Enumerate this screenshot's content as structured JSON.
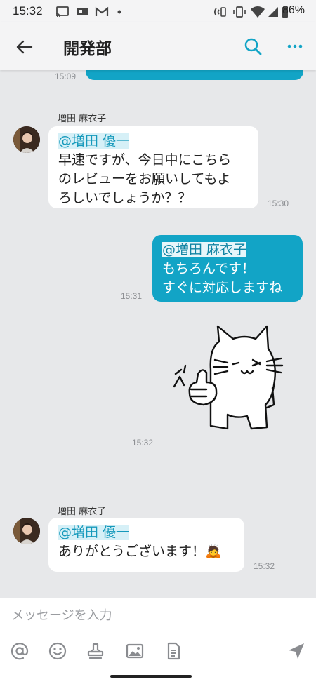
{
  "status_bar": {
    "time": "15:32",
    "battery": "86%"
  },
  "header": {
    "title": "開発部"
  },
  "messages": [
    {
      "time": "15:09"
    },
    {
      "sender": "増田 麻衣子",
      "mention": "@増田 優一",
      "lines": [
        "早速ですが、今日中にこちら",
        "のレビューをお願いしてもよ",
        "ろしいでしょうか？？"
      ],
      "time": "15:30"
    },
    {
      "mention": "@増田 麻衣子",
      "lines": [
        "もちろんです！",
        "すぐに対応しますね"
      ],
      "time": "15:31"
    },
    {
      "type": "sticker",
      "sticker": "cat-thumbs-up-sticker",
      "time": "15:32"
    },
    {
      "sender": "増田 麻衣子",
      "mention": "@増田 優一",
      "lines": [
        "ありがとうございます！"
      ],
      "emoji": "🙇",
      "time": "15:32"
    }
  ],
  "composer": {
    "placeholder": "メッセージを入力",
    "tools": [
      "mention-icon",
      "emoji-icon",
      "stamp-icon",
      "image-icon",
      "file-icon",
      "send-icon"
    ]
  },
  "colors": {
    "accent": "#12a4c6",
    "chat_bg": "#e7e8ea"
  }
}
